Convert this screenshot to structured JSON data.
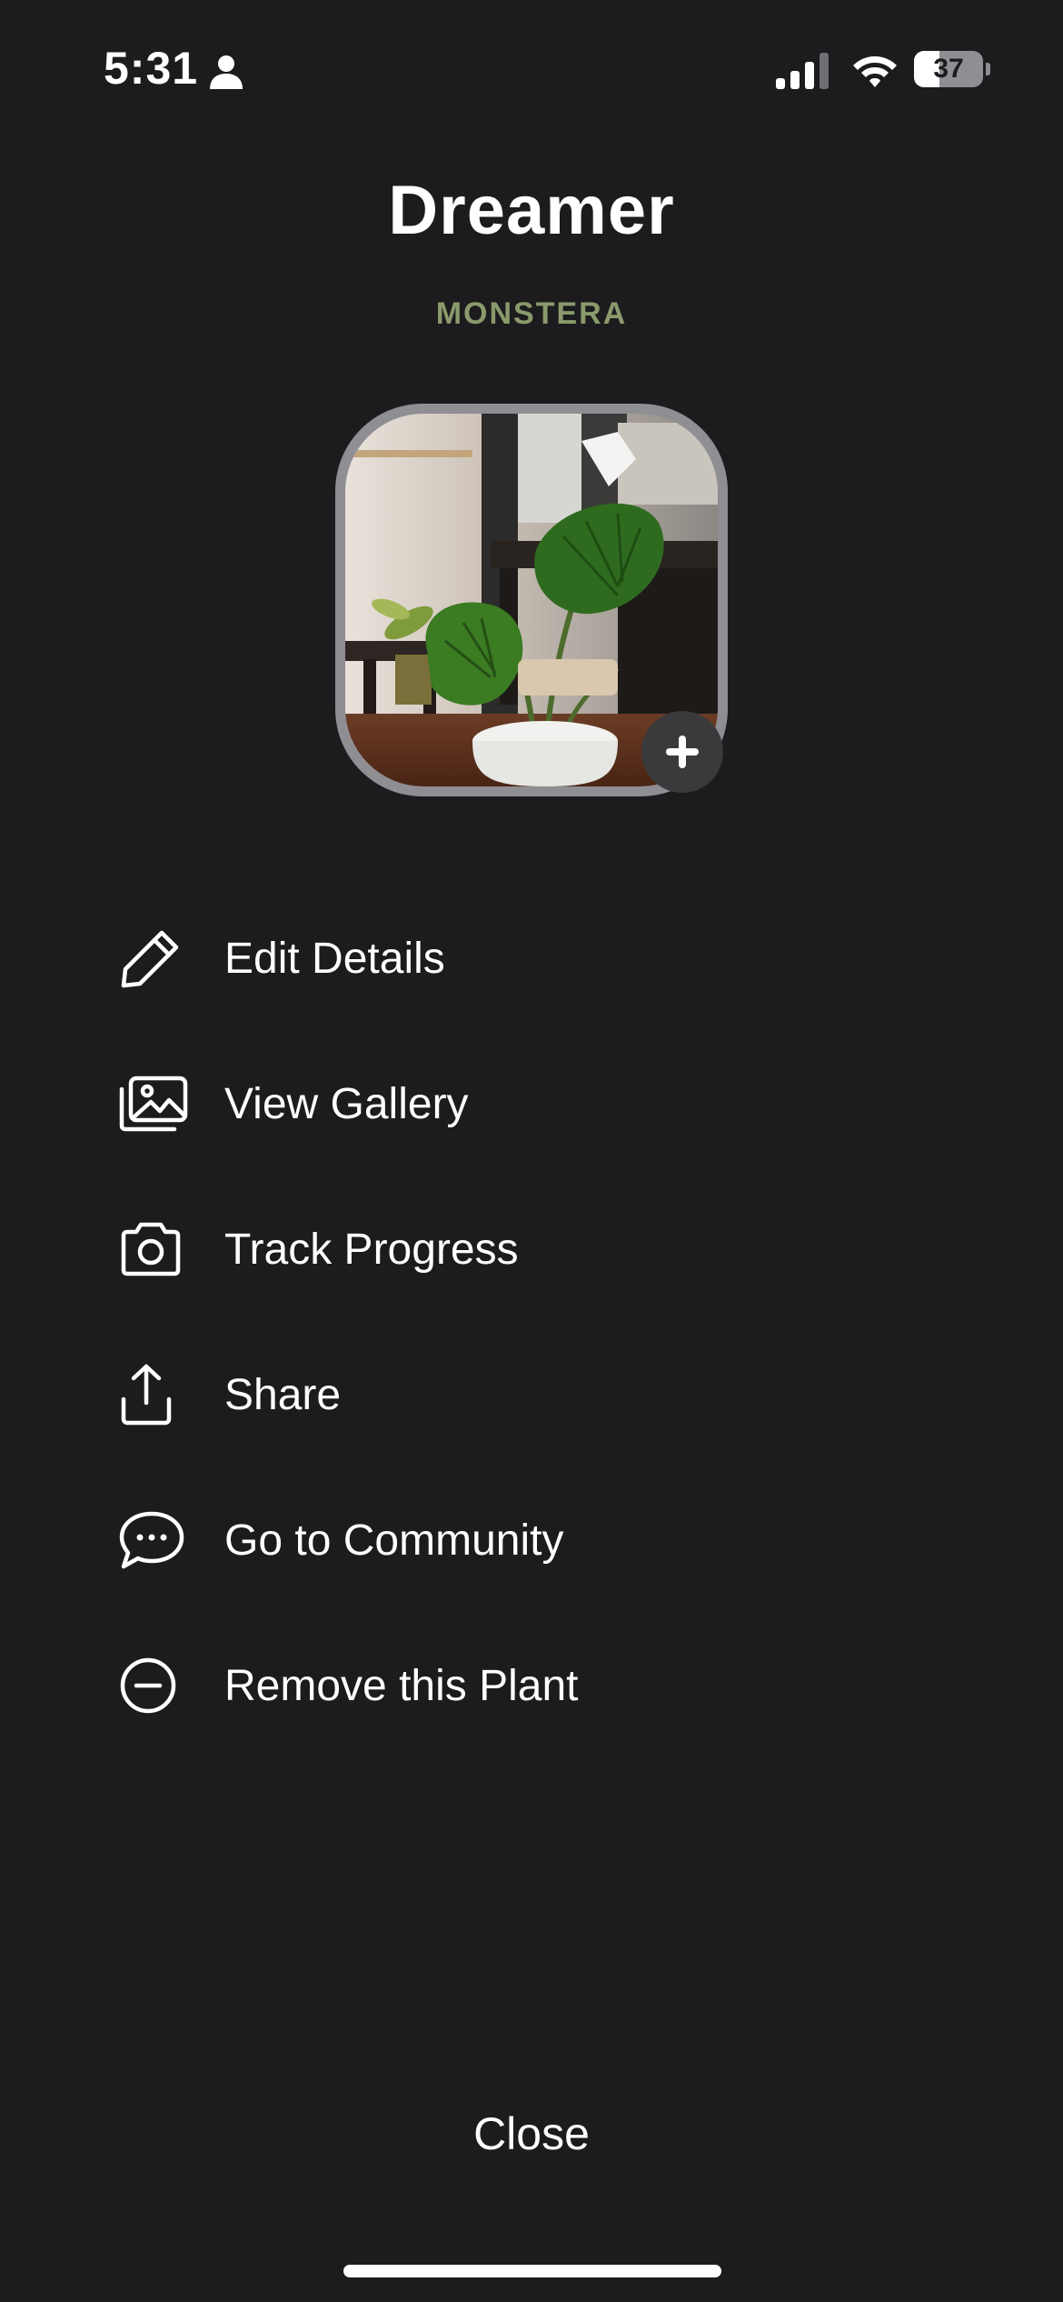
{
  "status_bar": {
    "time": "5:31",
    "battery_percent": "37",
    "battery_level": 0.37,
    "icons": [
      "person-icon",
      "cellular-signal-icon",
      "wifi-icon",
      "battery-icon"
    ]
  },
  "plant": {
    "name": "Dreamer",
    "species": "MONSTERA"
  },
  "photo": {
    "add_icon": "plus-icon"
  },
  "menu": {
    "items": [
      {
        "label": "Edit Details",
        "icon": "pencil-icon"
      },
      {
        "label": "View Gallery",
        "icon": "gallery-icon"
      },
      {
        "label": "Track Progress",
        "icon": "camera-icon"
      },
      {
        "label": "Share",
        "icon": "share-icon"
      },
      {
        "label": "Go to Community",
        "icon": "chat-bubble-icon"
      },
      {
        "label": "Remove this Plant",
        "icon": "minus-circle-icon"
      }
    ]
  },
  "close_label": "Close",
  "colors": {
    "background": "#1c1c1e",
    "species_accent": "#8a9a6c",
    "text": "#ffffff"
  }
}
